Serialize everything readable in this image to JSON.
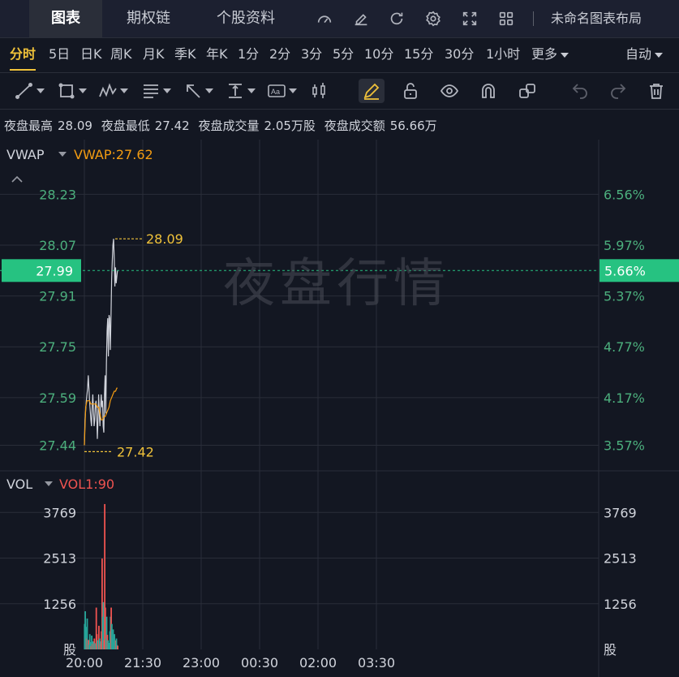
{
  "tabs": [
    {
      "label": "图表",
      "active": true
    },
    {
      "label": "期权链",
      "active": false
    },
    {
      "label": "个股资料",
      "active": false
    }
  ],
  "top_icons": [
    "gauge-icon",
    "pencil-edit-icon",
    "refresh-icon",
    "settings-gear-icon",
    "fullscreen-icon",
    "grid-layout-icon"
  ],
  "layout_name": "未命名图表布局",
  "timeframes": [
    {
      "label": "分时",
      "active": true
    },
    {
      "label": "5日"
    },
    {
      "label": "日K"
    },
    {
      "label": "周K"
    },
    {
      "label": "月K"
    },
    {
      "label": "季K"
    },
    {
      "label": "年K"
    },
    {
      "label": "1分"
    },
    {
      "label": "2分"
    },
    {
      "label": "3分"
    },
    {
      "label": "5分"
    },
    {
      "label": "10分"
    },
    {
      "label": "15分"
    },
    {
      "label": "30分"
    },
    {
      "label": "1小时"
    },
    {
      "label": "更多"
    }
  ],
  "auto_label": "自动",
  "tools": [
    "line-tool-icon",
    "rectangle-tool-icon",
    "pattern-tool-icon",
    "fib-tool-icon",
    "arrow-tool-icon",
    "measure-tool-icon",
    "text-tool-icon",
    "candle-tool-icon",
    "pencil-icon",
    "unlock-icon",
    "eye-icon",
    "magnet-icon",
    "link-icon",
    "undo-icon",
    "redo-icon",
    "trash-icon"
  ],
  "stats": {
    "high_label": "夜盘最高",
    "high_value": "28.09",
    "low_label": "夜盘最低",
    "low_value": "27.42",
    "volume_label": "夜盘成交量",
    "volume_value": "2.05万股",
    "turnover_label": "夜盘成交额",
    "turnover_value": "56.66万"
  },
  "watermark": "夜盘行情",
  "colors": {
    "background": "#131722",
    "up": "#26a69a",
    "down": "#ef5350",
    "price_axis": "#4caf7d",
    "current_price_bg": "#26c281",
    "vwap": "#f39c12",
    "price_line": "#d1d4dc",
    "marker": "#f0c23a"
  },
  "chart_data": {
    "type": "line",
    "price_panel": {
      "indicator_label": "VWAP",
      "indicator_value": "VWAP:27.62",
      "price_ticks": [
        "28.23",
        "28.07",
        "27.91",
        "27.75",
        "27.59",
        "27.44"
      ],
      "price_tick_values": [
        28.23,
        28.07,
        27.91,
        27.75,
        27.59,
        27.44
      ],
      "percent_ticks": [
        "6.56%",
        "5.97%",
        "5.37%",
        "4.77%",
        "4.17%",
        "3.57%"
      ],
      "current_price": "27.99",
      "current_price_value": 27.99,
      "current_percent": "5.66%",
      "high_marker": "28.09",
      "high_value": 28.09,
      "low_marker": "27.42",
      "low_value": 27.42,
      "y_range": [
        27.38,
        28.3
      ],
      "x_range_minutes": [
        0,
        459
      ],
      "price_series": [
        [
          0,
          27.44
        ],
        [
          1,
          27.52
        ],
        [
          3,
          27.58
        ],
        [
          5,
          27.62
        ],
        [
          6,
          27.66
        ],
        [
          7,
          27.62
        ],
        [
          8,
          27.58
        ],
        [
          10,
          27.52
        ],
        [
          11,
          27.5
        ],
        [
          12,
          27.56
        ],
        [
          13,
          27.6
        ],
        [
          14,
          27.55
        ],
        [
          15,
          27.5
        ],
        [
          16,
          27.52
        ],
        [
          17,
          27.57
        ],
        [
          18,
          27.58
        ],
        [
          19,
          27.54
        ],
        [
          20,
          27.46
        ],
        [
          21,
          27.52
        ],
        [
          22,
          27.6
        ],
        [
          23,
          27.54
        ],
        [
          24,
          27.5
        ],
        [
          25,
          27.56
        ],
        [
          26,
          27.6
        ],
        [
          27,
          27.56
        ],
        [
          28,
          27.58
        ],
        [
          29,
          27.5
        ],
        [
          30,
          27.48
        ],
        [
          31,
          27.6
        ],
        [
          32,
          27.66
        ],
        [
          33,
          27.54
        ],
        [
          34,
          27.7
        ],
        [
          35,
          27.8
        ],
        [
          36,
          27.84
        ],
        [
          37,
          27.72
        ],
        [
          38,
          27.85
        ],
        [
          39,
          27.84
        ],
        [
          40,
          27.74
        ],
        [
          41,
          27.84
        ],
        [
          42,
          27.96
        ],
        [
          43,
          28.02
        ],
        [
          44,
          28.07
        ],
        [
          45,
          28.09
        ],
        [
          46,
          28.03
        ],
        [
          47,
          27.94
        ],
        [
          48,
          28.0
        ],
        [
          49,
          27.95
        ],
        [
          50,
          27.97
        ],
        [
          51,
          27.99
        ]
      ],
      "vwap_series": [
        [
          0,
          27.44
        ],
        [
          2,
          27.56
        ],
        [
          4,
          27.58
        ],
        [
          6,
          27.58
        ],
        [
          8,
          27.58
        ],
        [
          10,
          27.57
        ],
        [
          12,
          27.57
        ],
        [
          14,
          27.57
        ],
        [
          16,
          27.57
        ],
        [
          18,
          27.57
        ],
        [
          20,
          27.56
        ],
        [
          22,
          27.56
        ],
        [
          24,
          27.54
        ],
        [
          26,
          27.52
        ],
        [
          28,
          27.52
        ],
        [
          30,
          27.53
        ],
        [
          32,
          27.53
        ],
        [
          34,
          27.54
        ],
        [
          36,
          27.55
        ],
        [
          38,
          27.56
        ],
        [
          40,
          27.58
        ],
        [
          42,
          27.59
        ],
        [
          44,
          27.6
        ],
        [
          46,
          27.61
        ],
        [
          48,
          27.61
        ],
        [
          50,
          27.62
        ],
        [
          51,
          27.62
        ]
      ]
    },
    "volume_panel": {
      "indicator_label": "VOL",
      "indicator_value": "VOL1:90",
      "volume_ticks": [
        "3769",
        "2513",
        "1256"
      ],
      "volume_tick_values": [
        3769,
        2513,
        1256
      ],
      "unit_label": "股",
      "y_range": [
        0,
        4200
      ],
      "bars": [
        {
          "x": 0,
          "v": 700,
          "c": "up"
        },
        {
          "x": 1,
          "v": 1050,
          "c": "up"
        },
        {
          "x": 2,
          "v": 620,
          "c": "up"
        },
        {
          "x": 3,
          "v": 300,
          "c": "down"
        },
        {
          "x": 4,
          "v": 850,
          "c": "up"
        },
        {
          "x": 5,
          "v": 180,
          "c": "up"
        },
        {
          "x": 6,
          "v": 260,
          "c": "down"
        },
        {
          "x": 7,
          "v": 130,
          "c": "up"
        },
        {
          "x": 8,
          "v": 420,
          "c": "up"
        },
        {
          "x": 9,
          "v": 200,
          "c": "up"
        },
        {
          "x": 10,
          "v": 90,
          "c": "down"
        },
        {
          "x": 11,
          "v": 380,
          "c": "up"
        },
        {
          "x": 12,
          "v": 150,
          "c": "down"
        },
        {
          "x": 13,
          "v": 220,
          "c": "up"
        },
        {
          "x": 14,
          "v": 110,
          "c": "up"
        },
        {
          "x": 15,
          "v": 300,
          "c": "down"
        },
        {
          "x": 16,
          "v": 170,
          "c": "up"
        },
        {
          "x": 17,
          "v": 80,
          "c": "up"
        },
        {
          "x": 18,
          "v": 1150,
          "c": "down"
        },
        {
          "x": 19,
          "v": 420,
          "c": "down"
        },
        {
          "x": 20,
          "v": 250,
          "c": "up"
        },
        {
          "x": 21,
          "v": 180,
          "c": "up"
        },
        {
          "x": 22,
          "v": 650,
          "c": "down"
        },
        {
          "x": 23,
          "v": 300,
          "c": "up"
        },
        {
          "x": 24,
          "v": 150,
          "c": "down"
        },
        {
          "x": 25,
          "v": 220,
          "c": "up"
        },
        {
          "x": 26,
          "v": 500,
          "c": "down"
        },
        {
          "x": 27,
          "v": 2500,
          "c": "down"
        },
        {
          "x": 28,
          "v": 900,
          "c": "up"
        },
        {
          "x": 29,
          "v": 1300,
          "c": "up"
        },
        {
          "x": 30,
          "v": 250,
          "c": "down"
        },
        {
          "x": 31,
          "v": 4000,
          "c": "down"
        },
        {
          "x": 32,
          "v": 1150,
          "c": "down"
        },
        {
          "x": 33,
          "v": 300,
          "c": "up"
        },
        {
          "x": 34,
          "v": 900,
          "c": "up"
        },
        {
          "x": 35,
          "v": 400,
          "c": "down"
        },
        {
          "x": 36,
          "v": 250,
          "c": "up"
        },
        {
          "x": 37,
          "v": 150,
          "c": "up"
        },
        {
          "x": 38,
          "v": 180,
          "c": "up"
        },
        {
          "x": 39,
          "v": 500,
          "c": "up"
        },
        {
          "x": 40,
          "v": 900,
          "c": "up"
        },
        {
          "x": 41,
          "v": 1150,
          "c": "down"
        },
        {
          "x": 42,
          "v": 700,
          "c": "up"
        },
        {
          "x": 43,
          "v": 300,
          "c": "up"
        },
        {
          "x": 44,
          "v": 550,
          "c": "up"
        },
        {
          "x": 45,
          "v": 200,
          "c": "up"
        },
        {
          "x": 46,
          "v": 420,
          "c": "up"
        },
        {
          "x": 47,
          "v": 150,
          "c": "up"
        },
        {
          "x": 48,
          "v": 250,
          "c": "down"
        },
        {
          "x": 49,
          "v": 300,
          "c": "up"
        },
        {
          "x": 50,
          "v": 120,
          "c": "up"
        },
        {
          "x": 51,
          "v": 100,
          "c": "down"
        }
      ]
    },
    "time_ticks": [
      "20:00",
      "21:30",
      "23:00",
      "00:30",
      "02:00",
      "03:30"
    ],
    "time_tick_minutes": [
      0,
      90,
      180,
      270,
      360,
      450
    ]
  }
}
